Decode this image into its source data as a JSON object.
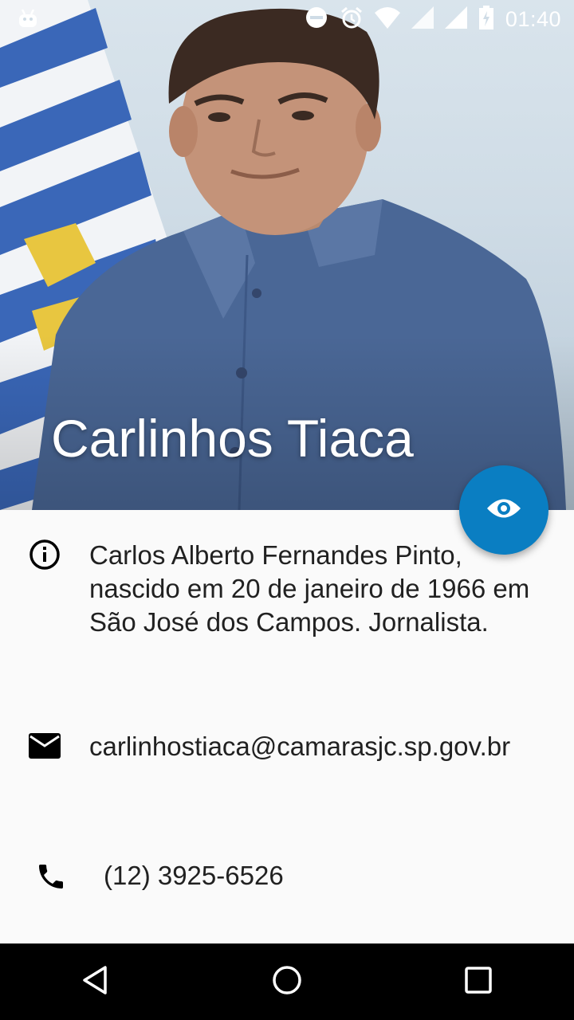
{
  "status_bar": {
    "time": "01:40",
    "icons": [
      "android-debug-icon",
      "do-not-disturb-icon",
      "alarm-icon",
      "wifi-icon",
      "cell-signal-icon",
      "cell-signal-icon",
      "battery-charging-icon"
    ]
  },
  "profile": {
    "name": "Carlinhos Tiaca",
    "bio": "Carlos Alberto Fernandes Pinto, nascido em 20 de janeiro de 1966 em São José dos Campos. Jornalista.",
    "email": "carlinhostiaca@camarasjc.sp.gov.br",
    "phone": "(12) 3925-6526"
  },
  "fab": {
    "icon": "eye-icon",
    "color": "#0a7ec2"
  },
  "nav": {
    "buttons": [
      "back-icon",
      "home-icon",
      "recents-icon"
    ]
  }
}
